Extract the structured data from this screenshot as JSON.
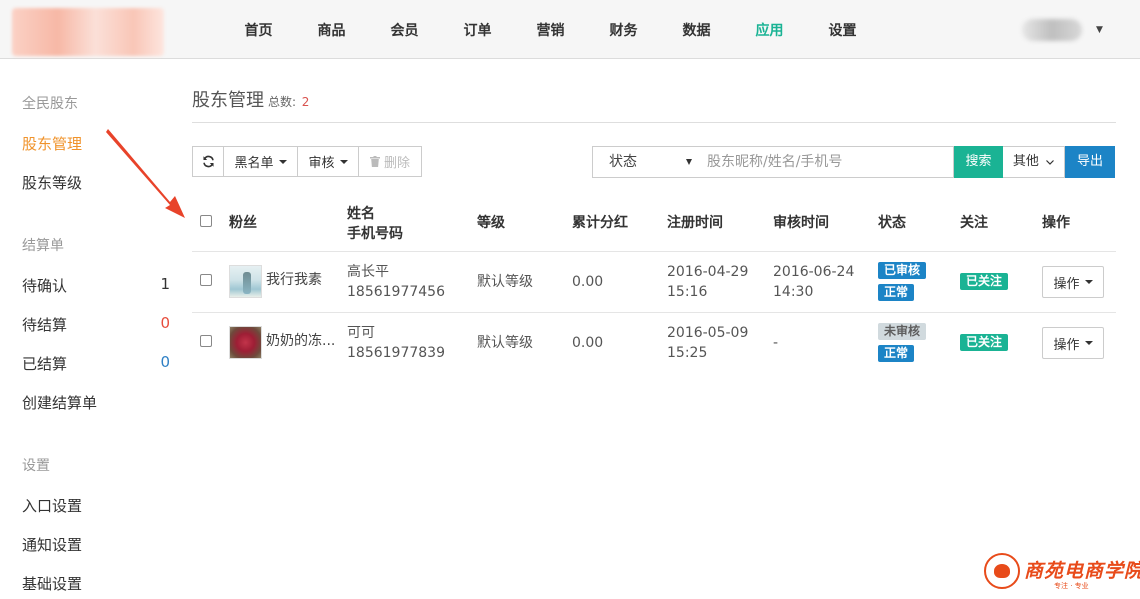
{
  "nav": {
    "items": [
      "首页",
      "商品",
      "会员",
      "订单",
      "营销",
      "财务",
      "数据",
      "应用",
      "设置"
    ],
    "active_index": 7
  },
  "sidebar": {
    "group1": "全民股东",
    "item_manage": "股东管理",
    "item_level": "股东等级",
    "group2": "结算单",
    "item_pending_confirm": "待确认",
    "count_pending_confirm": "1",
    "item_pending_settle": "待结算",
    "count_pending_settle": "0",
    "item_settled": "已结算",
    "count_settled": "0",
    "item_create": "创建结算单",
    "group3": "设置",
    "item_entry": "入口设置",
    "item_notice": "通知设置",
    "item_basic": "基础设置"
  },
  "page": {
    "title": "股东管理",
    "total_label": "总数:",
    "total_value": "2"
  },
  "toolbar": {
    "blacklist": "黑名单",
    "audit": "审核",
    "delete": "删除",
    "status_select": "状态",
    "search_placeholder": "股东昵称/姓名/手机号",
    "search": "搜索",
    "other": "其他",
    "export": "导出"
  },
  "table": {
    "headers": {
      "fans": "粉丝",
      "name": "姓名",
      "phone": "手机号码",
      "level": "等级",
      "dividend": "累计分红",
      "register_time": "注册时间",
      "audit_time": "审核时间",
      "status": "状态",
      "follow": "关注",
      "action": "操作"
    },
    "rows": [
      {
        "nickname": "我行我素",
        "name": "高长平",
        "phone": "18561977456",
        "level": "默认等级",
        "dividend": "0.00",
        "reg_date": "2016-04-29",
        "reg_time": "15:16",
        "audit_date": "2016-06-24",
        "audit_time": "14:30",
        "audit_status": "已审核",
        "account_status": "正常",
        "follow": "已关注",
        "action": "操作"
      },
      {
        "nickname": "奶奶的冻...",
        "name": "可可",
        "phone": "18561977839",
        "level": "默认等级",
        "dividend": "0.00",
        "reg_date": "2016-05-09",
        "reg_time": "15:25",
        "audit_date": "-",
        "audit_time": "",
        "audit_status": "未审核",
        "account_status": "正常",
        "follow": "已关注",
        "action": "操作"
      }
    ]
  },
  "watermark": {
    "text": "商苑电商学院",
    "sub": "专注 · 专业"
  },
  "colors": {
    "accent_green": "#1ab394",
    "primary_blue": "#1c84c6",
    "active_orange": "#f0932b",
    "annotation_red": "#e8432a"
  }
}
